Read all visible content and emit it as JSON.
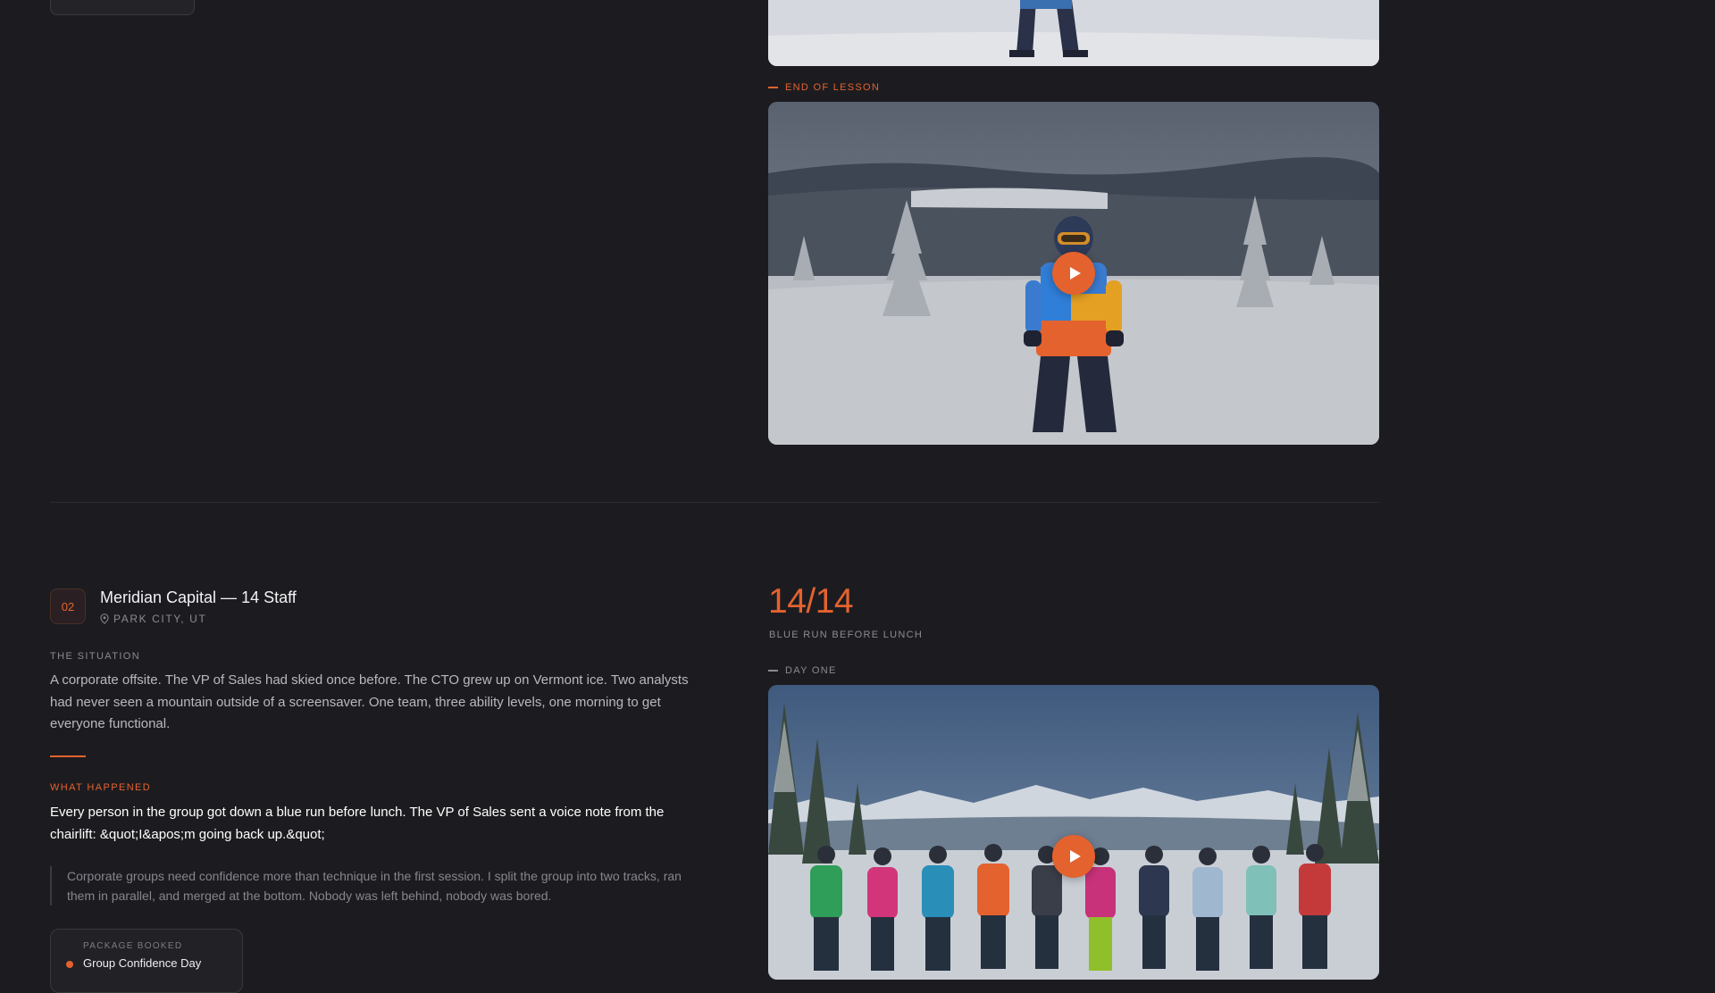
{
  "previous_case": {
    "section_label": "END OF LESSON"
  },
  "case": {
    "number": "02",
    "title": "Meridian Capital — 14 Staff",
    "location": "PARK CITY, UT",
    "situation_label": "THE SITUATION",
    "situation_text": "A corporate offsite. The VP of Sales had skied once before. The CTO grew up on Vermont ice. Two analysts had never seen a mountain outside of a screensaver. One team, three ability levels, one morning to get everyone functional.",
    "happened_label": "WHAT HAPPENED",
    "happened_text": "Every person in the group got down a blue run before lunch. The VP of Sales sent a voice note from the chairlift: &quot;I&apos;m going back up.&quot;",
    "quote_text": "Corporate groups need confidence more than technique in the first session. I split the group into two tracks, ran them in parallel, and merged at the bottom. Nobody was left behind, nobody was bored.",
    "package_label": "PACKAGE BOOKED",
    "package_name": "Group Confidence Day",
    "stat_value": "14/14",
    "stat_caption": "BLUE RUN BEFORE LUNCH",
    "video_label": "DAY ONE"
  },
  "colors": {
    "background": "#1c1c20",
    "accent": "#e4622e",
    "text_primary": "#f2f2f4",
    "text_muted": "#8a8a92"
  },
  "icons": {
    "play": "play-icon",
    "location": "location-pin-icon",
    "package_status": "status-dot-icon"
  }
}
